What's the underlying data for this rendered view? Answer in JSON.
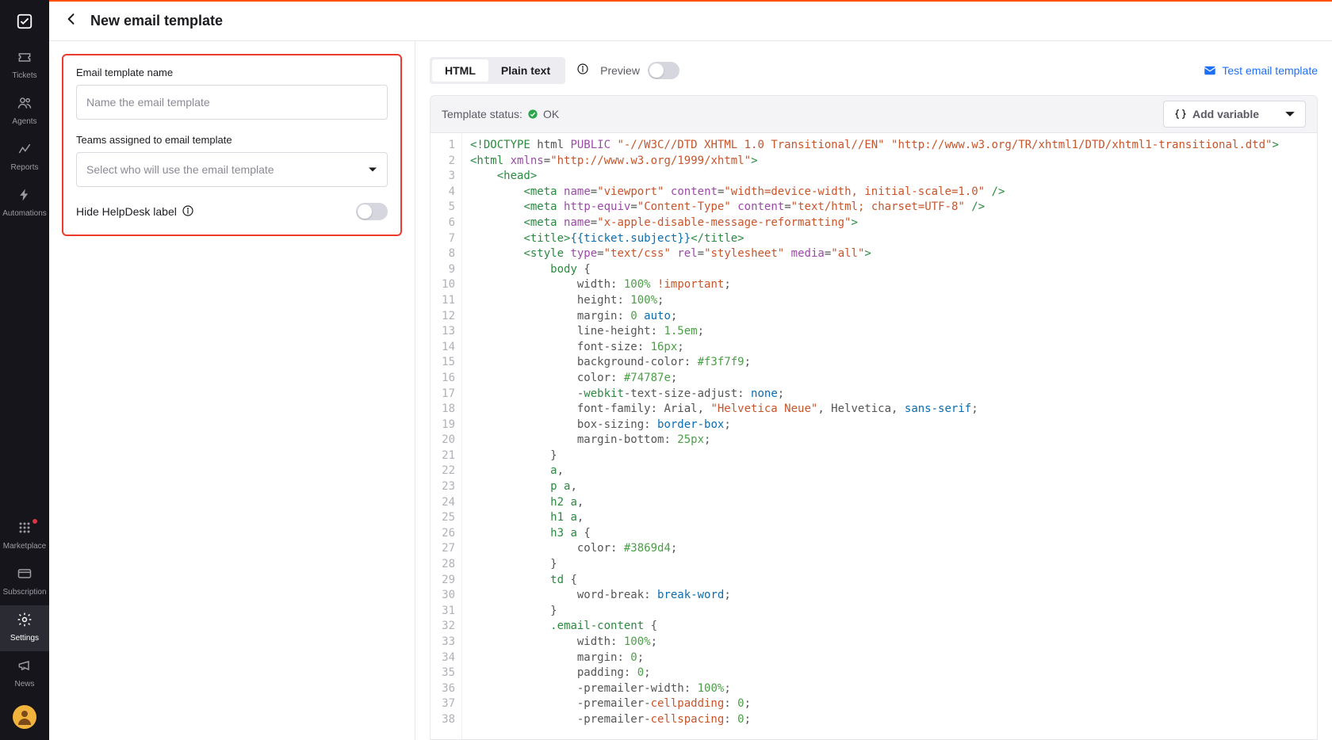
{
  "sidebar": {
    "items_top": [
      {
        "key": "tickets",
        "label": "Tickets",
        "icon": "ticket"
      },
      {
        "key": "agents",
        "label": "Agents",
        "icon": "users"
      },
      {
        "key": "reports",
        "label": "Reports",
        "icon": "chart"
      },
      {
        "key": "automations",
        "label": "Automations",
        "icon": "bolt"
      }
    ],
    "items_bottom": [
      {
        "key": "marketplace",
        "label": "Marketplace",
        "icon": "grid",
        "badge": true
      },
      {
        "key": "subscription",
        "label": "Subscription",
        "icon": "card"
      },
      {
        "key": "settings",
        "label": "Settings",
        "icon": "gear",
        "active": true
      },
      {
        "key": "news",
        "label": "News",
        "icon": "megaphone"
      }
    ]
  },
  "header": {
    "title": "New email template"
  },
  "form": {
    "name_label": "Email template name",
    "name_placeholder": "Name the email template",
    "teams_label": "Teams assigned to email template",
    "teams_placeholder": "Select who will use the email template",
    "hide_label": "Hide HelpDesk label"
  },
  "toolbar": {
    "seg_html": "HTML",
    "seg_plain": "Plain text",
    "preview_label": "Preview",
    "test_link": "Test email template",
    "status_label": "Template status:",
    "status_value": "OK",
    "add_variable": "Add variable"
  },
  "code_lines": [
    [
      [
        "tag",
        "<!DOCTYPE"
      ],
      [
        "txt",
        " html "
      ],
      [
        "attr",
        "PUBLIC"
      ],
      [
        "txt",
        " "
      ],
      [
        "str",
        "\"-//W3C//DTD XHTML 1.0 Transitional//EN\""
      ],
      [
        "txt",
        " "
      ],
      [
        "str",
        "\"http://www.w3.org/TR/xhtml1/DTD/xhtml1-transitional.dtd\""
      ],
      [
        "tag",
        ">"
      ]
    ],
    [
      [
        "tag",
        "<html"
      ],
      [
        "txt",
        " "
      ],
      [
        "attr",
        "xmlns"
      ],
      [
        "punc",
        "="
      ],
      [
        "str",
        "\"http://www.w3.org/1999/xhtml\""
      ],
      [
        "tag",
        ">"
      ]
    ],
    [
      [
        "txt",
        "    "
      ],
      [
        "tag",
        "<head>"
      ]
    ],
    [
      [
        "txt",
        "        "
      ],
      [
        "tag",
        "<meta"
      ],
      [
        "txt",
        " "
      ],
      [
        "attr",
        "name"
      ],
      [
        "punc",
        "="
      ],
      [
        "str",
        "\"viewport\""
      ],
      [
        "txt",
        " "
      ],
      [
        "attr",
        "content"
      ],
      [
        "punc",
        "="
      ],
      [
        "str",
        "\"width=device-width, initial-scale=1.0\""
      ],
      [
        "txt",
        " "
      ],
      [
        "tag",
        "/>"
      ]
    ],
    [
      [
        "txt",
        "        "
      ],
      [
        "tag",
        "<meta"
      ],
      [
        "txt",
        " "
      ],
      [
        "attr",
        "http-equiv"
      ],
      [
        "punc",
        "="
      ],
      [
        "str",
        "\"Content-Type\""
      ],
      [
        "txt",
        " "
      ],
      [
        "attr",
        "content"
      ],
      [
        "punc",
        "="
      ],
      [
        "str",
        "\"text/html; charset=UTF-8\""
      ],
      [
        "txt",
        " "
      ],
      [
        "tag",
        "/>"
      ]
    ],
    [
      [
        "txt",
        "        "
      ],
      [
        "tag",
        "<meta"
      ],
      [
        "txt",
        " "
      ],
      [
        "attr",
        "name"
      ],
      [
        "punc",
        "="
      ],
      [
        "str",
        "\"x-apple-disable-message-reformatting\""
      ],
      [
        "tag",
        ">"
      ]
    ],
    [
      [
        "txt",
        "        "
      ],
      [
        "tag",
        "<title>"
      ],
      [
        "var",
        "{{ticket.subject}}"
      ],
      [
        "tag",
        "</title>"
      ]
    ],
    [
      [
        "txt",
        "        "
      ],
      [
        "tag",
        "<style"
      ],
      [
        "txt",
        " "
      ],
      [
        "attr",
        "type"
      ],
      [
        "punc",
        "="
      ],
      [
        "str",
        "\"text/css\""
      ],
      [
        "txt",
        " "
      ],
      [
        "attr",
        "rel"
      ],
      [
        "punc",
        "="
      ],
      [
        "str",
        "\"stylesheet\""
      ],
      [
        "txt",
        " "
      ],
      [
        "attr",
        "media"
      ],
      [
        "punc",
        "="
      ],
      [
        "str",
        "\"all\""
      ],
      [
        "tag",
        ">"
      ]
    ],
    [
      [
        "txt",
        "            "
      ],
      [
        "sel",
        "body"
      ],
      [
        "txt",
        " "
      ],
      [
        "punc",
        "{"
      ]
    ],
    [
      [
        "txt",
        "                "
      ],
      [
        "prop",
        "width"
      ],
      [
        "punc",
        ": "
      ],
      [
        "num",
        "100%"
      ],
      [
        "txt",
        " "
      ],
      [
        "imp",
        "!important"
      ],
      [
        "punc",
        ";"
      ]
    ],
    [
      [
        "txt",
        "                "
      ],
      [
        "prop",
        "height"
      ],
      [
        "punc",
        ": "
      ],
      [
        "num",
        "100%"
      ],
      [
        "punc",
        ";"
      ]
    ],
    [
      [
        "txt",
        "                "
      ],
      [
        "prop",
        "margin"
      ],
      [
        "punc",
        ": "
      ],
      [
        "num",
        "0"
      ],
      [
        "txt",
        " "
      ],
      [
        "kw",
        "auto"
      ],
      [
        "punc",
        ";"
      ]
    ],
    [
      [
        "txt",
        "                "
      ],
      [
        "prop",
        "line-height"
      ],
      [
        "punc",
        ": "
      ],
      [
        "num",
        "1.5em"
      ],
      [
        "punc",
        ";"
      ]
    ],
    [
      [
        "txt",
        "                "
      ],
      [
        "prop",
        "font-size"
      ],
      [
        "punc",
        ": "
      ],
      [
        "num",
        "16px"
      ],
      [
        "punc",
        ";"
      ]
    ],
    [
      [
        "txt",
        "                "
      ],
      [
        "prop",
        "background-color"
      ],
      [
        "punc",
        ": "
      ],
      [
        "num",
        "#f3f7f9"
      ],
      [
        "punc",
        ";"
      ]
    ],
    [
      [
        "txt",
        "                "
      ],
      [
        "prop",
        "color"
      ],
      [
        "punc",
        ": "
      ],
      [
        "num",
        "#74787e"
      ],
      [
        "punc",
        ";"
      ]
    ],
    [
      [
        "txt",
        "                "
      ],
      [
        "txt",
        "-"
      ],
      [
        "sel",
        "webkit"
      ],
      [
        "prop",
        "-text-size-adjust"
      ],
      [
        "punc",
        ": "
      ],
      [
        "kw",
        "none"
      ],
      [
        "punc",
        ";"
      ]
    ],
    [
      [
        "txt",
        "                "
      ],
      [
        "prop",
        "font-family"
      ],
      [
        "punc",
        ": "
      ],
      [
        "txt",
        "Arial, "
      ],
      [
        "str",
        "\"Helvetica Neue\""
      ],
      [
        "txt",
        ", Helvetica, "
      ],
      [
        "kw",
        "sans-serif"
      ],
      [
        "punc",
        ";"
      ]
    ],
    [
      [
        "txt",
        "                "
      ],
      [
        "prop",
        "box-sizing"
      ],
      [
        "punc",
        ": "
      ],
      [
        "kw",
        "border-box"
      ],
      [
        "punc",
        ";"
      ]
    ],
    [
      [
        "txt",
        "                "
      ],
      [
        "prop",
        "margin-bottom"
      ],
      [
        "punc",
        ": "
      ],
      [
        "num",
        "25px"
      ],
      [
        "punc",
        ";"
      ]
    ],
    [
      [
        "txt",
        "            "
      ],
      [
        "punc",
        "}"
      ]
    ],
    [
      [
        "txt",
        "            "
      ],
      [
        "sel",
        "a"
      ],
      [
        "punc",
        ","
      ]
    ],
    [
      [
        "txt",
        "            "
      ],
      [
        "sel",
        "p a"
      ],
      [
        "punc",
        ","
      ]
    ],
    [
      [
        "txt",
        "            "
      ],
      [
        "sel",
        "h2 a"
      ],
      [
        "punc",
        ","
      ]
    ],
    [
      [
        "txt",
        "            "
      ],
      [
        "sel",
        "h1 a"
      ],
      [
        "punc",
        ","
      ]
    ],
    [
      [
        "txt",
        "            "
      ],
      [
        "sel",
        "h3 a"
      ],
      [
        "txt",
        " "
      ],
      [
        "punc",
        "{"
      ]
    ],
    [
      [
        "txt",
        "                "
      ],
      [
        "prop",
        "color"
      ],
      [
        "punc",
        ": "
      ],
      [
        "num",
        "#3869d4"
      ],
      [
        "punc",
        ";"
      ]
    ],
    [
      [
        "txt",
        "            "
      ],
      [
        "punc",
        "}"
      ]
    ],
    [
      [
        "txt",
        "            "
      ],
      [
        "sel",
        "td"
      ],
      [
        "txt",
        " "
      ],
      [
        "punc",
        "{"
      ]
    ],
    [
      [
        "txt",
        "                "
      ],
      [
        "prop",
        "word-break"
      ],
      [
        "punc",
        ": "
      ],
      [
        "kw",
        "break-word"
      ],
      [
        "punc",
        ";"
      ]
    ],
    [
      [
        "txt",
        "            "
      ],
      [
        "punc",
        "}"
      ]
    ],
    [
      [
        "txt",
        "            "
      ],
      [
        "sel",
        ".email-content"
      ],
      [
        "txt",
        " "
      ],
      [
        "punc",
        "{"
      ]
    ],
    [
      [
        "txt",
        "                "
      ],
      [
        "prop",
        "width"
      ],
      [
        "punc",
        ": "
      ],
      [
        "num",
        "100%"
      ],
      [
        "punc",
        ";"
      ]
    ],
    [
      [
        "txt",
        "                "
      ],
      [
        "prop",
        "margin"
      ],
      [
        "punc",
        ": "
      ],
      [
        "num",
        "0"
      ],
      [
        "punc",
        ";"
      ]
    ],
    [
      [
        "txt",
        "                "
      ],
      [
        "prop",
        "padding"
      ],
      [
        "punc",
        ": "
      ],
      [
        "num",
        "0"
      ],
      [
        "punc",
        ";"
      ]
    ],
    [
      [
        "txt",
        "                "
      ],
      [
        "prop",
        "-premailer-"
      ],
      [
        "prop",
        "width"
      ],
      [
        "punc",
        ": "
      ],
      [
        "num",
        "100%"
      ],
      [
        "punc",
        ";"
      ]
    ],
    [
      [
        "txt",
        "                "
      ],
      [
        "prop",
        "-premailer-"
      ],
      [
        "prem",
        "cellpadding"
      ],
      [
        "punc",
        ": "
      ],
      [
        "num",
        "0"
      ],
      [
        "punc",
        ";"
      ]
    ],
    [
      [
        "txt",
        "                "
      ],
      [
        "prop",
        "-premailer-"
      ],
      [
        "prem",
        "cellspacing"
      ],
      [
        "punc",
        ": "
      ],
      [
        "num",
        "0"
      ],
      [
        "punc",
        ";"
      ]
    ]
  ]
}
